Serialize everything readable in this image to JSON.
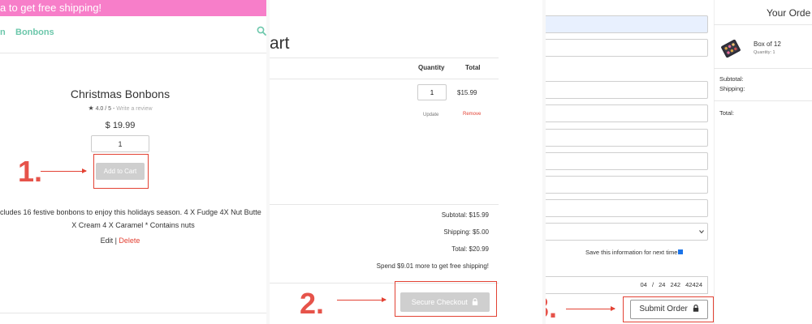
{
  "colors": {
    "accent": "#e34234",
    "promo": "#f77ec9",
    "nav_link": "#6cc7ab",
    "disabled_button": "#cfcfcf",
    "autofill": "#e8f0fe"
  },
  "step1": {
    "promo_text": "a to get free shipping!",
    "nav": [
      "n",
      "Bonbons"
    ],
    "product_title": "Christmas Bonbons",
    "rating": "4.0 / 5",
    "rating_sep": " - ",
    "write_review": "Write a review",
    "price": "$ 19.99",
    "quantity": "1",
    "add_to_cart": "Add to Cart",
    "step_label": "1.",
    "description_line1": "cludes 16 festive bonbons to enjoy this holidays season. 4 X Fudge 4X Nut Butte",
    "description_line2": "X Cream 4 X Caramel * Contains nuts",
    "edit": "Edit",
    "edit_sep": " | ",
    "delete": "Delete"
  },
  "step2": {
    "title": "art",
    "col_quantity": "Quantity",
    "col_total": "Total",
    "quantity": "1",
    "line_total": "$15.99",
    "update": "Update",
    "remove": "Remove",
    "subtotal": "Subtotal: $15.99",
    "shipping": "Shipping: $5.00",
    "total": "Total: $20.99",
    "free_shipping_note": "Spend $9.01 more to get free shipping!",
    "checkout_label": "Secure Checkout",
    "step_label": "2."
  },
  "step3": {
    "save_info": "Save this information for next time",
    "card_details": "04 / 24   242   42424",
    "submit_label": "Submit Order",
    "step_label": "3.",
    "order_title": "Your Orde",
    "item_name": "Box of 12",
    "item_qty": "Quantity: 1",
    "subtotal_label": "Subtotal:",
    "shipping_label": "Shipping:",
    "total_label": "Total:"
  }
}
